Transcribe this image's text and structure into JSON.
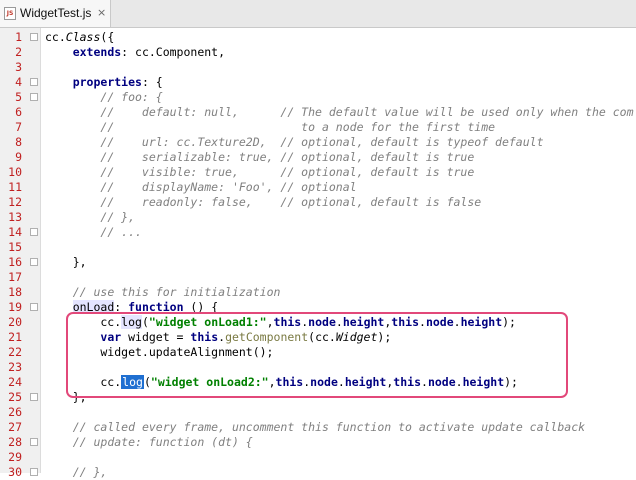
{
  "tab": {
    "icon": "js-file-icon",
    "icon_text": "JS",
    "title": "WidgetTest.js",
    "close_glyph": "×"
  },
  "colors": {
    "highlight_box": "#e2487a",
    "line_numbers": "#c02020",
    "keyword": "#000080",
    "comment": "#808080",
    "string": "#008000",
    "selection": "#1f6fd1"
  },
  "lines": [
    {
      "n": "1",
      "segs": [
        {
          "t": "cc."
        },
        {
          "t": "Class",
          "c": "it"
        },
        {
          "t": "({"
        }
      ]
    },
    {
      "n": "2",
      "segs": [
        {
          "t": "    "
        },
        {
          "t": "extends",
          "c": "kw"
        },
        {
          "t": ": cc.Component,"
        }
      ]
    },
    {
      "n": "3",
      "segs": [
        {
          "t": ""
        }
      ]
    },
    {
      "n": "4",
      "segs": [
        {
          "t": "    "
        },
        {
          "t": "properties",
          "c": "kw"
        },
        {
          "t": ": {"
        }
      ]
    },
    {
      "n": "5",
      "segs": [
        {
          "t": "        "
        },
        {
          "t": "// foo: {",
          "c": "cm"
        }
      ]
    },
    {
      "n": "6",
      "segs": [
        {
          "t": "        "
        },
        {
          "t": "//    default: null,      // The default value will be used only when the com",
          "c": "cm"
        }
      ]
    },
    {
      "n": "7",
      "segs": [
        {
          "t": "        "
        },
        {
          "t": "//                           to a node for the first time",
          "c": "cm"
        }
      ]
    },
    {
      "n": "8",
      "segs": [
        {
          "t": "        "
        },
        {
          "t": "//    url: cc.Texture2D,  // optional, default is typeof default",
          "c": "cm"
        }
      ]
    },
    {
      "n": "9",
      "segs": [
        {
          "t": "        "
        },
        {
          "t": "//    serializable: true, // optional, default is true",
          "c": "cm"
        }
      ]
    },
    {
      "n": "10",
      "segs": [
        {
          "t": "        "
        },
        {
          "t": "//    visible: true,      // optional, default is true",
          "c": "cm"
        }
      ]
    },
    {
      "n": "11",
      "segs": [
        {
          "t": "        "
        },
        {
          "t": "//    displayName: 'Foo', // optional",
          "c": "cm"
        }
      ]
    },
    {
      "n": "12",
      "segs": [
        {
          "t": "        "
        },
        {
          "t": "//    readonly: false,    // optional, default is false",
          "c": "cm"
        }
      ]
    },
    {
      "n": "13",
      "segs": [
        {
          "t": "        "
        },
        {
          "t": "// },",
          "c": "cm"
        }
      ]
    },
    {
      "n": "14",
      "segs": [
        {
          "t": "        "
        },
        {
          "t": "// ...",
          "c": "cm"
        }
      ]
    },
    {
      "n": "15",
      "segs": [
        {
          "t": ""
        }
      ]
    },
    {
      "n": "16",
      "segs": [
        {
          "t": "    },"
        }
      ]
    },
    {
      "n": "17",
      "segs": [
        {
          "t": ""
        }
      ]
    },
    {
      "n": "18",
      "segs": [
        {
          "t": "    "
        },
        {
          "t": "// use this for initialization",
          "c": "cm"
        }
      ]
    },
    {
      "n": "19",
      "segs": [
        {
          "t": "    "
        },
        {
          "t": "onLoad",
          "c": "hl"
        },
        {
          "t": ": "
        },
        {
          "t": "function",
          "c": "kw"
        },
        {
          "t": " () {"
        }
      ]
    },
    {
      "n": "20",
      "segs": [
        {
          "t": "        cc."
        },
        {
          "t": "log",
          "c": "hl"
        },
        {
          "t": "("
        },
        {
          "t": "\"widget onLoad1:\"",
          "c": "str"
        },
        {
          "t": ","
        },
        {
          "t": "this",
          "c": "kw"
        },
        {
          "t": "."
        },
        {
          "t": "node",
          "c": "kw"
        },
        {
          "t": "."
        },
        {
          "t": "height",
          "c": "kw"
        },
        {
          "t": ","
        },
        {
          "t": "this",
          "c": "kw"
        },
        {
          "t": "."
        },
        {
          "t": "node",
          "c": "kw"
        },
        {
          "t": "."
        },
        {
          "t": "height",
          "c": "kw"
        },
        {
          "t": ");"
        }
      ]
    },
    {
      "n": "21",
      "segs": [
        {
          "t": "        "
        },
        {
          "t": "var",
          "c": "kw"
        },
        {
          "t": " widget = "
        },
        {
          "t": "this",
          "c": "kw"
        },
        {
          "t": "."
        },
        {
          "t": "getComponent",
          "c": "meth"
        },
        {
          "t": "(cc."
        },
        {
          "t": "Widget",
          "c": "it"
        },
        {
          "t": ");"
        }
      ]
    },
    {
      "n": "22",
      "segs": [
        {
          "t": "        widget.updateAlignment();"
        }
      ]
    },
    {
      "n": "23",
      "segs": [
        {
          "t": ""
        }
      ]
    },
    {
      "n": "24",
      "segs": [
        {
          "t": "        cc."
        },
        {
          "t": "log",
          "c": "sel"
        },
        {
          "t": "("
        },
        {
          "t": "\"widget onLoad2:\"",
          "c": "str"
        },
        {
          "t": ","
        },
        {
          "t": "this",
          "c": "kw"
        },
        {
          "t": "."
        },
        {
          "t": "node",
          "c": "kw"
        },
        {
          "t": "."
        },
        {
          "t": "height",
          "c": "kw"
        },
        {
          "t": ","
        },
        {
          "t": "this",
          "c": "kw"
        },
        {
          "t": "."
        },
        {
          "t": "node",
          "c": "kw"
        },
        {
          "t": "."
        },
        {
          "t": "height",
          "c": "kw"
        },
        {
          "t": ");"
        }
      ]
    },
    {
      "n": "25",
      "segs": [
        {
          "t": "    },"
        }
      ]
    },
    {
      "n": "26",
      "segs": [
        {
          "t": ""
        }
      ]
    },
    {
      "n": "27",
      "segs": [
        {
          "t": "    "
        },
        {
          "t": "// called every frame, uncomment this function to activate update callback",
          "c": "cm"
        }
      ]
    },
    {
      "n": "28",
      "segs": [
        {
          "t": "    "
        },
        {
          "t": "// update: function (dt) {",
          "c": "cm"
        }
      ]
    },
    {
      "n": "29",
      "segs": [
        {
          "t": ""
        }
      ]
    },
    {
      "n": "30",
      "segs": [
        {
          "t": "    "
        },
        {
          "t": "// },",
          "c": "cm"
        }
      ]
    }
  ]
}
